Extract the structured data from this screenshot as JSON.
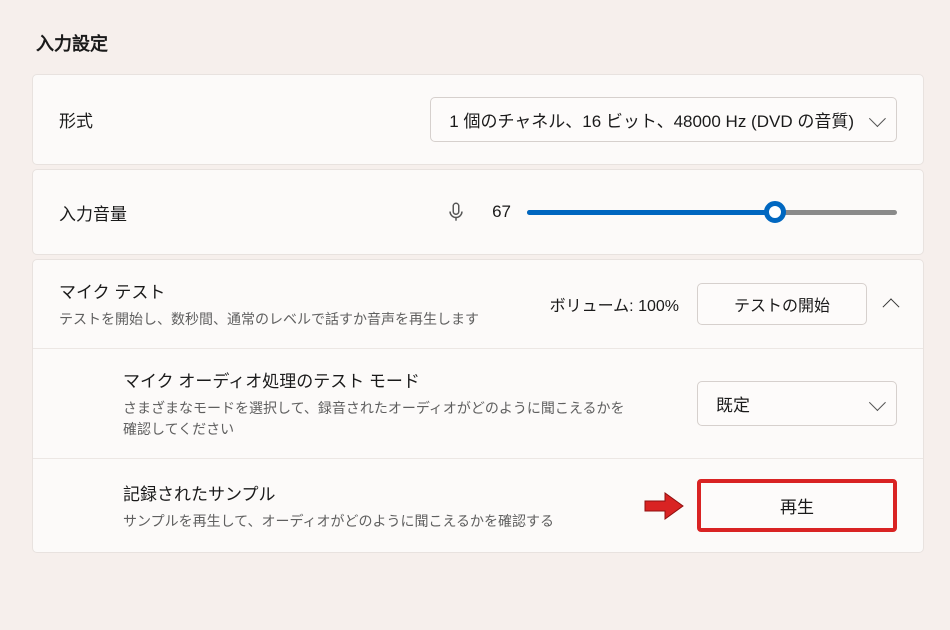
{
  "section_title": "入力設定",
  "format": {
    "label": "形式",
    "selected": "1 個のチャネル、16 ビット、48000 Hz (DVD の音質)"
  },
  "input_volume": {
    "label": "入力音量",
    "value": 67,
    "max": 100
  },
  "mic_test": {
    "title": "マイク テスト",
    "desc": "テストを開始し、数秒間、通常のレベルで話すか音声を再生します",
    "volume_status_prefix": "ボリューム: ",
    "volume_status_value": "100%",
    "start_button": "テストの開始"
  },
  "processing_mode": {
    "title": "マイク オーディオ処理のテスト モード",
    "desc": "さまざまなモードを選択して、録音されたオーディオがどのように聞こえるかを確認してください",
    "selected": "既定"
  },
  "recorded_sample": {
    "title": "記録されたサンプル",
    "desc": "サンプルを再生して、オーディオがどのように聞こえるかを確認する",
    "play_button": "再生"
  },
  "colors": {
    "accent": "#0067c0",
    "annotation": "#d92323"
  }
}
